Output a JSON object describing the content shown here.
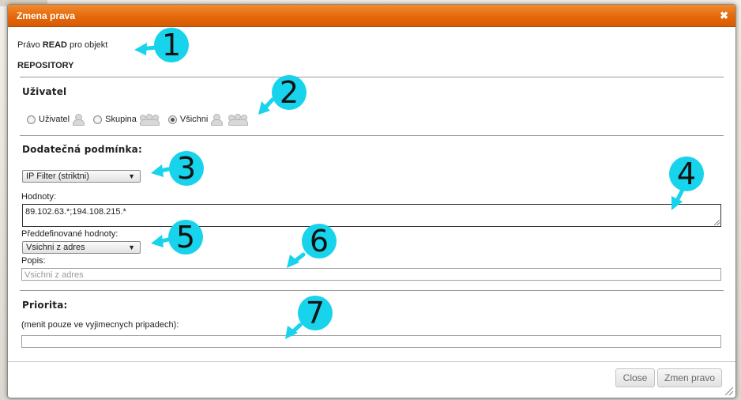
{
  "dialog": {
    "title": "Zmena prava",
    "close_glyph": "✖",
    "header": {
      "prefix": "Právo",
      "right": "READ",
      "suffix": "pro objekt",
      "object": "REPOSITORY"
    },
    "user_section": {
      "title": "Uživatel",
      "options": [
        {
          "label": "Uživatel",
          "icon": "user-icon",
          "checked": false
        },
        {
          "label": "Skupina",
          "icon": "group-icon",
          "checked": false
        },
        {
          "label": "Všichni",
          "icon": "everyone-icon",
          "checked": true
        }
      ]
    },
    "condition_section": {
      "title": "Dodatečná podmínka:",
      "condition_select": "IP Filter (striktni)",
      "values_label": "Hodnoty:",
      "values": "89.102.63.*;194.108.215.*",
      "predefined_label": "Předdefinované hodnoty:",
      "predefined_select": "Vsichni z adres",
      "description_label": "Popis:",
      "description_placeholder": "Vsichni z adres"
    },
    "priority_section": {
      "title": "Priorita:",
      "hint": "(menit pouze ve vyjimecnych pripadech):",
      "value": ""
    },
    "buttons": {
      "close": "Close",
      "submit": "Zmen pravo"
    }
  },
  "callouts": [
    "1",
    "2",
    "3",
    "4",
    "5",
    "6",
    "7"
  ],
  "colors": {
    "titlebar": "#e36609",
    "callout": "#17d3ec"
  }
}
